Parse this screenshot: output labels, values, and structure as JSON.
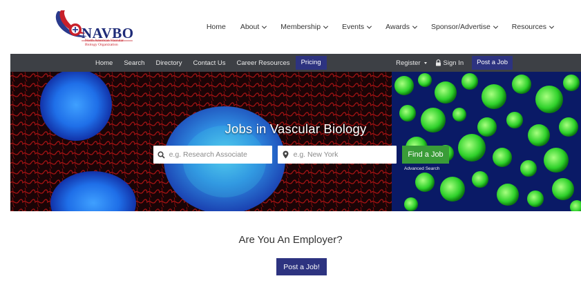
{
  "brand": {
    "name": "NAVBO",
    "tagline": "North American Vascular Biology Organization"
  },
  "main_nav": [
    {
      "label": "Home",
      "dropdown": false
    },
    {
      "label": "About",
      "dropdown": true
    },
    {
      "label": "Membership",
      "dropdown": true
    },
    {
      "label": "Events",
      "dropdown": true
    },
    {
      "label": "Awards",
      "dropdown": true
    },
    {
      "label": "Sponsor/Advertise",
      "dropdown": true
    },
    {
      "label": "Resources",
      "dropdown": true
    }
  ],
  "sub_nav": {
    "left": [
      "Home",
      "Search",
      "Directory",
      "Contact Us",
      "Career Resources",
      "Pricing"
    ],
    "active": "Pricing",
    "register": "Register",
    "sign_in": "Sign In",
    "post_job": "Post a Job"
  },
  "hero": {
    "title": "Jobs in Vascular Biology",
    "keyword_placeholder": "e.g. Research Associate",
    "location_placeholder": "e.g. New York",
    "find_button": "Find a Job",
    "advanced_search": "Advanced Search"
  },
  "employer": {
    "heading": "Are You An Employer?",
    "button": "Post a Job!"
  },
  "colors": {
    "nav_dark": "#3d4045",
    "brand_blue": "#2d3380",
    "find_green": "#3a9c38",
    "logo_red": "#c8202a"
  }
}
